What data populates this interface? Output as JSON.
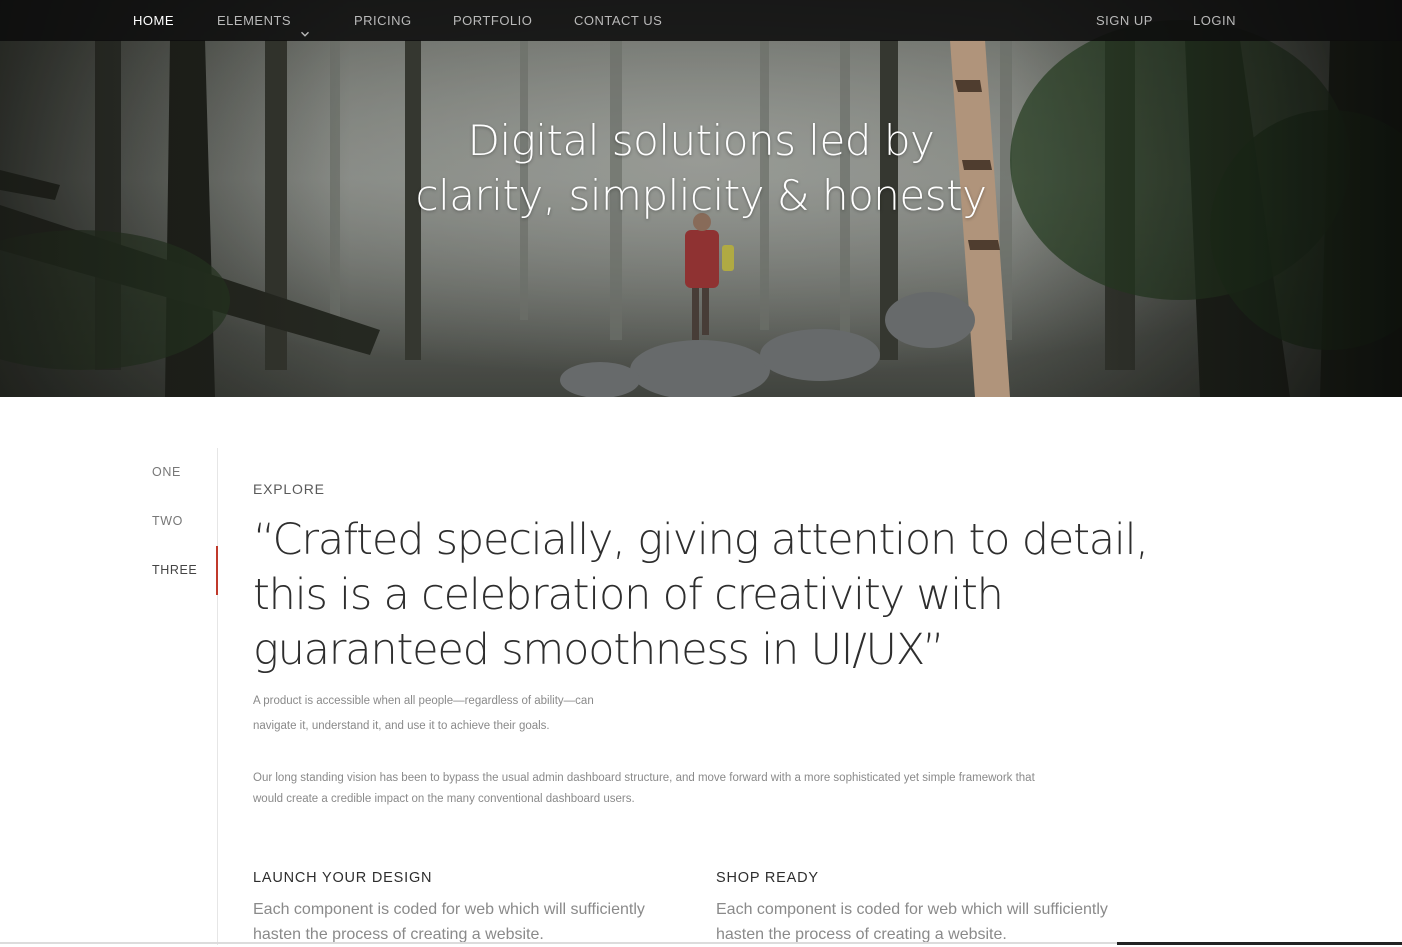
{
  "nav": {
    "left": [
      {
        "label": "HOME",
        "active": true
      },
      {
        "label": "ELEMENTS",
        "has_dropdown": true
      },
      {
        "label": "PRICING"
      },
      {
        "label": "PORTFOLIO"
      },
      {
        "label": "CONTACT US"
      }
    ],
    "right": [
      {
        "label": "SIGN UP"
      },
      {
        "label": "LOGIN"
      }
    ]
  },
  "hero": {
    "title_line1": "Digital solutions led by",
    "title_line2": "clarity, simplicity & honesty"
  },
  "sidenav": {
    "items": [
      {
        "label": "ONE"
      },
      {
        "label": "TWO"
      },
      {
        "label": "THREE",
        "active": true
      }
    ]
  },
  "content": {
    "eyebrow": "EXPLORE",
    "quote_line1": "“Crafted specially, giving attention to detail,",
    "quote_line2": "this is a celebration of creativity with",
    "quote_line3": "guaranteed smoothness in UI/UX”",
    "small_para_line1": "A product is accessible when all people—regardless of ability—can",
    "small_para_line2": "navigate it, understand it, and use it to achieve their goals.",
    "wide_para_line1": "Our long standing vision has been to bypass the usual admin dashboard structure, and move forward with a more sophisticated yet simple framework that",
    "wide_para_line2": "would create a credible impact on the many conventional dashboard users.",
    "features": [
      {
        "title": "LAUNCH YOUR DESIGN",
        "desc_line1": "Each component is coded for web which will sufficiently",
        "desc_line2": "hasten the process of creating a website."
      },
      {
        "title": "SHOP READY",
        "desc_line1": "Each component is coded for web which will sufficiently",
        "desc_line2": "hasten the process of creating a website."
      }
    ]
  },
  "colors": {
    "nav_bg": "#0c0c0c",
    "accent": "#c0392b",
    "heading": "#2e2e2e",
    "muted": "#8a8a8a"
  }
}
